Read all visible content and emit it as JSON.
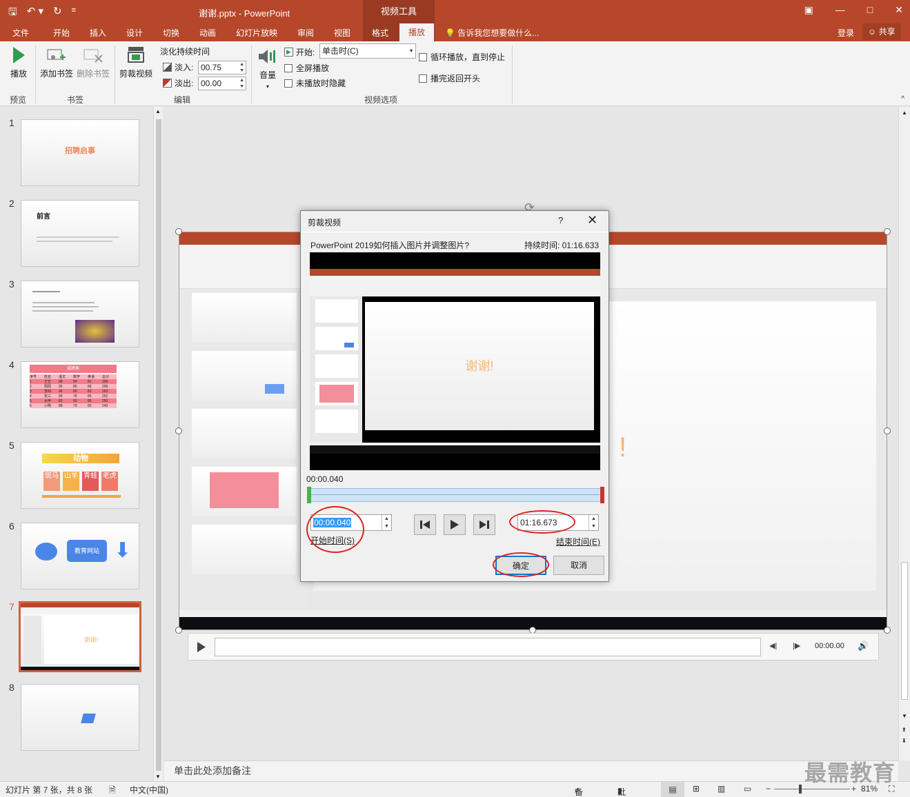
{
  "titlebar": {
    "doc_title": "谢谢.pptx - PowerPoint",
    "context_tool": "视频工具"
  },
  "tabs": [
    "文件",
    "开始",
    "插入",
    "设计",
    "切换",
    "动画",
    "幻灯片放映",
    "审阅",
    "视图",
    "格式",
    "播放"
  ],
  "active_tab": "播放",
  "tell_me": "告诉我您想要做什么...",
  "account": {
    "login": "登录",
    "share": "共享"
  },
  "ribbon": {
    "play": "播放",
    "add_bookmark": "添加书签",
    "remove_bookmark": "删除书签",
    "trim_video": "剪裁视频",
    "fade_duration": "淡化持续时间",
    "fade_in_label": "淡入:",
    "fade_in_value": "00.75",
    "fade_out_label": "淡出:",
    "fade_out_value": "00.00",
    "volume": "音量",
    "start_label": "开始:",
    "start_value": "单击时(C)",
    "fullscreen": "全屏播放",
    "hide_not_playing": "未播放时隐藏",
    "loop": "循环播放，直到停止",
    "rewind": "播完返回开头",
    "groups": {
      "preview": "预览",
      "bookmarks": "书签",
      "edit": "编辑",
      "video_options": "视频选项"
    }
  },
  "slides": [
    {
      "num": "1",
      "title": "招聘启事"
    },
    {
      "num": "2",
      "title": "前言"
    },
    {
      "num": "3",
      "title": ""
    },
    {
      "num": "4",
      "title": "成绩表"
    },
    {
      "num": "5",
      "title": "动物"
    },
    {
      "num": "6",
      "title": "教育网站"
    },
    {
      "num": "7",
      "title": "谢谢!"
    },
    {
      "num": "8",
      "title": ""
    }
  ],
  "slide4_table": {
    "headers": [
      "序号",
      "姓名",
      "语文",
      "数学",
      "英语",
      "总分"
    ],
    "rows": [
      [
        "1",
        "王五",
        "98",
        "90",
        "81",
        "269"
      ],
      [
        "2",
        "周周",
        "95",
        "85",
        "88",
        "268"
      ],
      [
        "3",
        "李四",
        "96",
        "80",
        "83",
        "263"
      ],
      [
        "4",
        "张三",
        "89",
        "78",
        "85",
        "252"
      ],
      [
        "5",
        "太甲",
        "80",
        "90",
        "85",
        "255"
      ],
      [
        "6",
        "小明",
        "88",
        "79",
        "82",
        "249"
      ]
    ]
  },
  "slide5_words": [
    "斑马",
    "山羊",
    "青蛙",
    "老虎"
  ],
  "selected_slide": "7",
  "dialog": {
    "title": "剪裁视频",
    "help": "?",
    "video_name": "PowerPoint 2019如何插入图片并调整图片?",
    "duration": "持续时间: 01:16.633",
    "current_time": "00:00.040",
    "start_time": "00:00.040",
    "start_label": "开始时间(S)",
    "end_time": "01:16.673",
    "end_label": "结束时间(E)",
    "ok": "确定",
    "cancel": "取消",
    "preview_thanks": "谢谢!"
  },
  "player": {
    "time": "00:00.00"
  },
  "notes_placeholder": "单击此处添加备注",
  "statusbar": {
    "slide_info": "幻灯片 第 7 张，共 8 张",
    "language": "中文(中国)",
    "notes": "备注",
    "comments": "批注",
    "zoom": "81%"
  },
  "watermark": "最需教育",
  "colors": {
    "accent": "#b7472a",
    "ring": "#e02020",
    "selected_border": "#d0603d"
  }
}
